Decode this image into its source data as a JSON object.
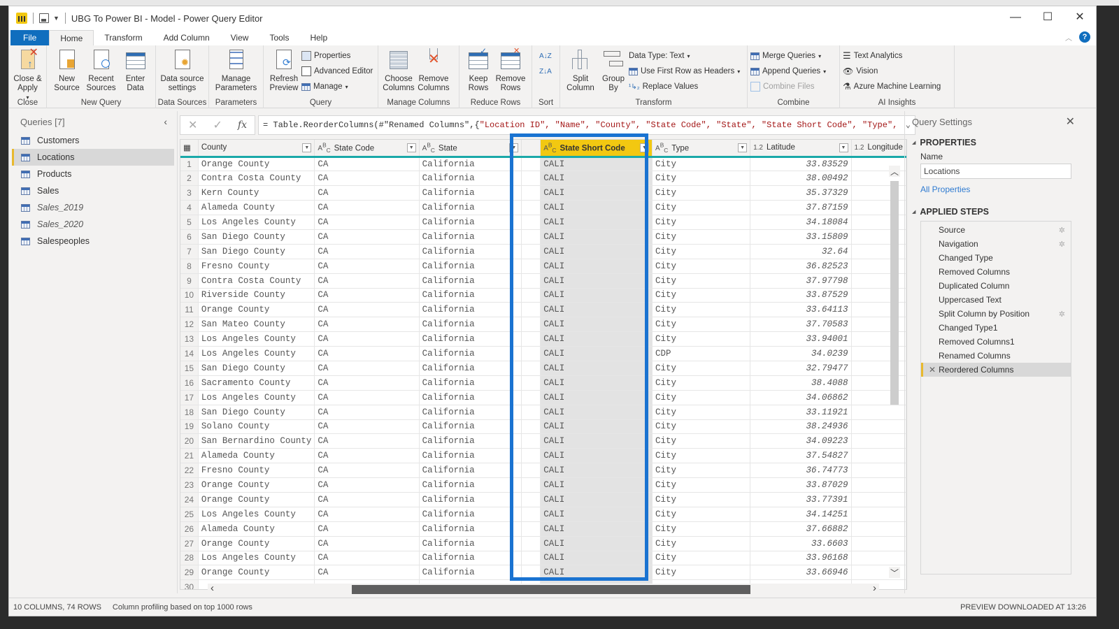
{
  "window": {
    "title": "UBG To Power BI - Model - Power Query Editor",
    "controls": {
      "minimize": "—",
      "maximize": "☐",
      "close": "✕"
    }
  },
  "tabs": [
    {
      "label": "File"
    },
    {
      "label": "Home"
    },
    {
      "label": "Transform"
    },
    {
      "label": "Add Column"
    },
    {
      "label": "View"
    },
    {
      "label": "Tools"
    },
    {
      "label": "Help"
    }
  ],
  "active_tab": "Home",
  "ribbon": {
    "close": {
      "group": "Close",
      "close_apply": "Close & Apply"
    },
    "new_query": {
      "group": "New Query",
      "new_source": "New Source",
      "recent_sources": "Recent Sources",
      "enter_data": "Enter Data"
    },
    "data_sources": {
      "group": "Data Sources",
      "settings": "Data source settings"
    },
    "parameters": {
      "group": "Parameters",
      "manage": "Manage Parameters"
    },
    "query": {
      "group": "Query",
      "refresh": "Refresh Preview",
      "properties": "Properties",
      "advanced_editor": "Advanced Editor",
      "manage": "Manage"
    },
    "manage_columns": {
      "group": "Manage Columns",
      "choose": "Choose Columns",
      "remove": "Remove Columns"
    },
    "reduce_rows": {
      "group": "Reduce Rows",
      "keep": "Keep Rows",
      "remove": "Remove Rows"
    },
    "sort": {
      "group": "Sort"
    },
    "transform": {
      "group": "Transform",
      "split": "Split Column",
      "group_by": "Group By",
      "data_type": "Data Type: Text",
      "first_row": "Use First Row as Headers",
      "replace": "Replace Values"
    },
    "combine": {
      "group": "Combine",
      "merge": "Merge Queries",
      "append": "Append Queries",
      "combine_files": "Combine Files"
    },
    "ai": {
      "group": "AI Insights",
      "text_analytics": "Text Analytics",
      "vision": "Vision",
      "azure_ml": "Azure Machine Learning"
    }
  },
  "queries": {
    "title": "Queries [7]",
    "items": [
      {
        "label": "Customers",
        "italic": false,
        "selected": false
      },
      {
        "label": "Locations",
        "italic": false,
        "selected": true
      },
      {
        "label": "Products",
        "italic": false,
        "selected": false
      },
      {
        "label": "Sales",
        "italic": false,
        "selected": false
      },
      {
        "label": "Sales_2019",
        "italic": true,
        "selected": false
      },
      {
        "label": "Sales_2020",
        "italic": true,
        "selected": false
      },
      {
        "label": "Salespeoples",
        "italic": false,
        "selected": false
      }
    ]
  },
  "formula": {
    "prefix": "= Table.ReorderColumns(#\"Renamed Columns\",{",
    "args": "\"Location ID\", \"Name\", \"County\", \"State Code\", \"State\", \"State Short Code\", \"Type\","
  },
  "grid": {
    "columns": [
      {
        "name": "County",
        "type": ""
      },
      {
        "name": "State Code",
        "type": "ABC"
      },
      {
        "name": "State",
        "type": "ABC"
      },
      {
        "name": "State Short Code",
        "type": "ABC",
        "selected": true
      },
      {
        "name": "Type",
        "type": "ABC"
      },
      {
        "name": "Latitude",
        "type": "1.2"
      },
      {
        "name": "Longitude",
        "type": "1.2"
      }
    ],
    "rows": [
      [
        "Orange County",
        "CA",
        "California",
        "CALI",
        "City",
        "33.83529"
      ],
      [
        "Contra Costa County",
        "CA",
        "California",
        "CALI",
        "City",
        "38.00492"
      ],
      [
        "Kern County",
        "CA",
        "California",
        "CALI",
        "City",
        "35.37329"
      ],
      [
        "Alameda County",
        "CA",
        "California",
        "CALI",
        "City",
        "37.87159"
      ],
      [
        "Los Angeles County",
        "CA",
        "California",
        "CALI",
        "City",
        "34.18084"
      ],
      [
        "San Diego County",
        "CA",
        "California",
        "CALI",
        "City",
        "33.15809"
      ],
      [
        "San Diego County",
        "CA",
        "California",
        "CALI",
        "City",
        "32.64"
      ],
      [
        "Fresno County",
        "CA",
        "California",
        "CALI",
        "City",
        "36.82523"
      ],
      [
        "Contra Costa County",
        "CA",
        "California",
        "CALI",
        "City",
        "37.97798"
      ],
      [
        "Riverside County",
        "CA",
        "California",
        "CALI",
        "City",
        "33.87529"
      ],
      [
        "Orange County",
        "CA",
        "California",
        "CALI",
        "City",
        "33.64113"
      ],
      [
        "San Mateo County",
        "CA",
        "California",
        "CALI",
        "City",
        "37.70583"
      ],
      [
        "Los Angeles County",
        "CA",
        "California",
        "CALI",
        "City",
        "33.94001"
      ],
      [
        "Los Angeles County",
        "CA",
        "California",
        "CALI",
        "CDP",
        "34.0239"
      ],
      [
        "San Diego County",
        "CA",
        "California",
        "CALI",
        "City",
        "32.79477"
      ],
      [
        "Sacramento County",
        "CA",
        "California",
        "CALI",
        "City",
        "38.4088"
      ],
      [
        "Los Angeles County",
        "CA",
        "California",
        "CALI",
        "City",
        "34.06862"
      ],
      [
        "San Diego County",
        "CA",
        "California",
        "CALI",
        "City",
        "33.11921"
      ],
      [
        "Solano County",
        "CA",
        "California",
        "CALI",
        "City",
        "38.24936"
      ],
      [
        "San Bernardino County",
        "CA",
        "California",
        "CALI",
        "City",
        "34.09223"
      ],
      [
        "Alameda County",
        "CA",
        "California",
        "CALI",
        "City",
        "37.54827"
      ],
      [
        "Fresno County",
        "CA",
        "California",
        "CALI",
        "City",
        "36.74773"
      ],
      [
        "Orange County",
        "CA",
        "California",
        "CALI",
        "City",
        "33.87029"
      ],
      [
        "Orange County",
        "CA",
        "California",
        "CALI",
        "City",
        "33.77391"
      ],
      [
        "Los Angeles County",
        "CA",
        "California",
        "CALI",
        "City",
        "34.14251"
      ],
      [
        "Alameda County",
        "CA",
        "California",
        "CALI",
        "City",
        "37.66882"
      ],
      [
        "Orange County",
        "CA",
        "California",
        "CALI",
        "City",
        "33.6603"
      ],
      [
        "Los Angeles County",
        "CA",
        "California",
        "CALI",
        "City",
        "33.96168"
      ],
      [
        "Orange County",
        "CA",
        "California",
        "CALI",
        "City",
        "33.66946"
      ],
      [
        "",
        "",
        "",
        "",
        "",
        ""
      ]
    ]
  },
  "settings": {
    "title": "Query Settings",
    "properties_label": "PROPERTIES",
    "name_label": "Name",
    "name_value": "Locations",
    "all_properties": "All Properties",
    "steps_label": "APPLIED STEPS",
    "steps": [
      {
        "label": "Source",
        "gear": true
      },
      {
        "label": "Navigation",
        "gear": true
      },
      {
        "label": "Changed Type",
        "gear": false
      },
      {
        "label": "Removed Columns",
        "gear": false
      },
      {
        "label": "Duplicated Column",
        "gear": false
      },
      {
        "label": "Uppercased Text",
        "gear": false
      },
      {
        "label": "Split Column by Position",
        "gear": true
      },
      {
        "label": "Changed Type1",
        "gear": false
      },
      {
        "label": "Removed Columns1",
        "gear": false
      },
      {
        "label": "Renamed Columns",
        "gear": false
      },
      {
        "label": "Reordered Columns",
        "gear": false,
        "selected": true
      }
    ]
  },
  "status": {
    "summary": "10 COLUMNS, 74 ROWS",
    "profiling": "Column profiling based on top 1000 rows",
    "preview": "PREVIEW DOWNLOADED AT 13:26"
  },
  "colors": {
    "accent_blue": "#106ebe",
    "selected_column_header": "#f2c811",
    "highlight_box": "#1a73d1",
    "header_underline": "#1aa9a9"
  }
}
